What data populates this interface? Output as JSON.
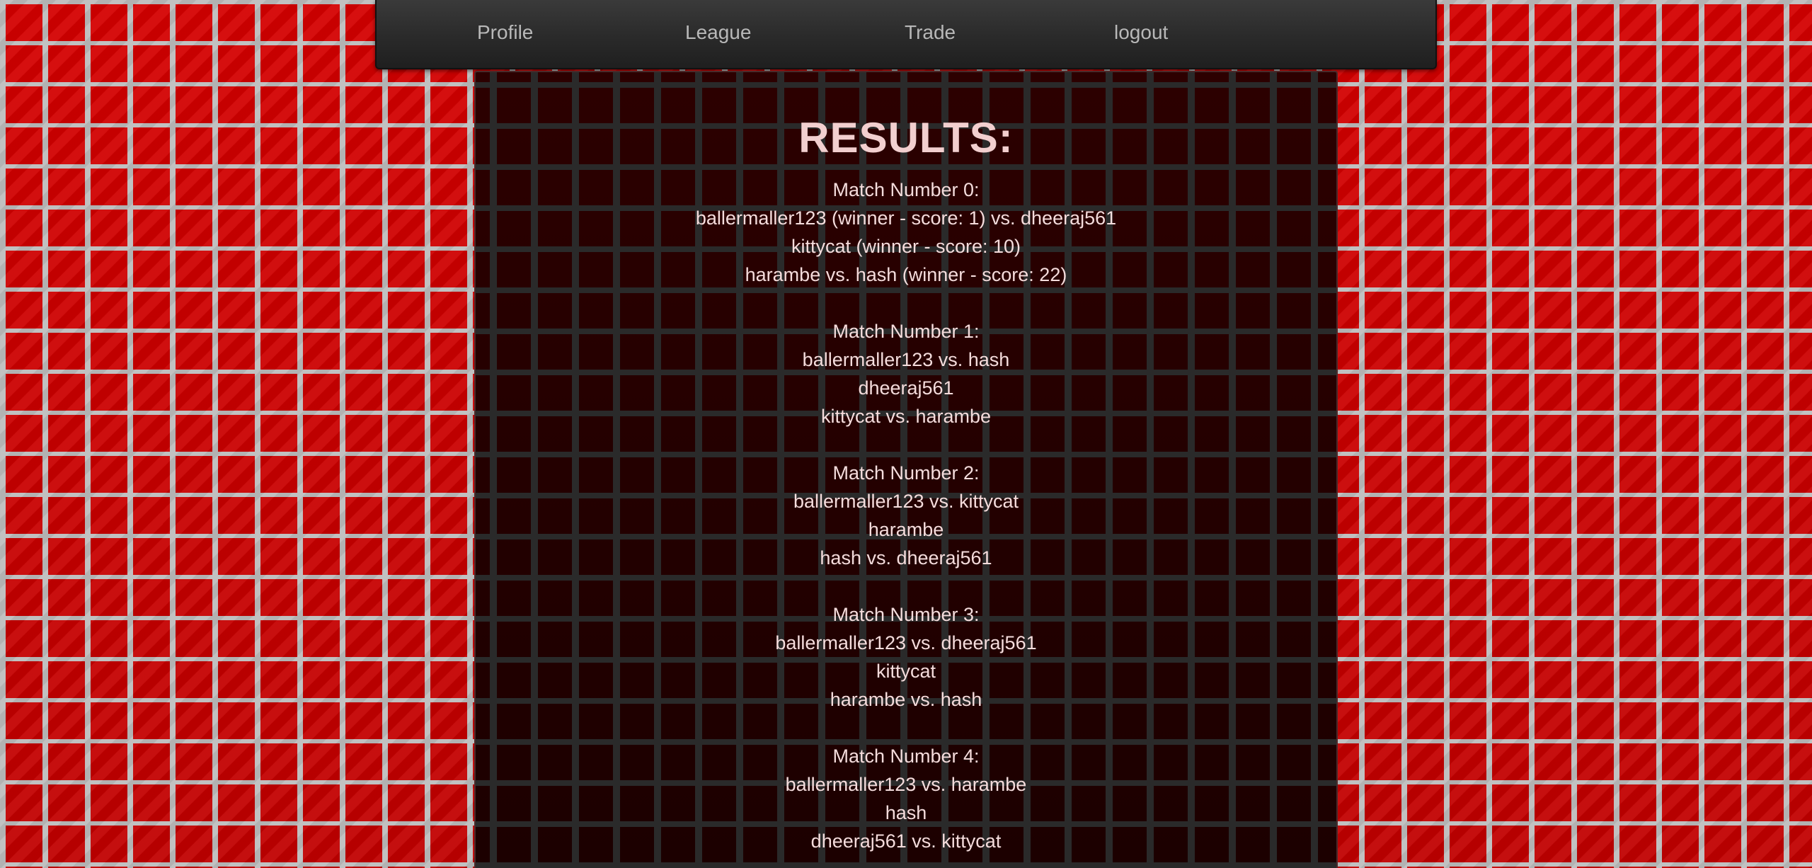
{
  "nav": {
    "profile": "Profile",
    "league": "League",
    "trade": "Trade",
    "logout": "logout"
  },
  "results": {
    "title": "RESULTS:",
    "matches": [
      {
        "header": "Match Number 0:",
        "lines": [
          "ballermaller123 (winner - score: 1) vs. dheeraj561",
          "kittycat (winner - score: 10)",
          "harambe vs. hash (winner - score: 22)"
        ]
      },
      {
        "header": "Match Number 1:",
        "lines": [
          "ballermaller123 vs. hash",
          "dheeraj561",
          "kittycat vs. harambe"
        ]
      },
      {
        "header": "Match Number 2:",
        "lines": [
          "ballermaller123 vs. kittycat",
          "harambe",
          "hash vs. dheeraj561"
        ]
      },
      {
        "header": "Match Number 3:",
        "lines": [
          "ballermaller123 vs. dheeraj561",
          "kittycat",
          "harambe vs. hash"
        ]
      },
      {
        "header": "Match Number 4:",
        "lines": [
          "ballermaller123 vs. harambe",
          "hash",
          "dheeraj561 vs. kittycat"
        ]
      }
    ]
  },
  "colors": {
    "brick": "#c00000",
    "mortar": "#bdbdbd",
    "nav_bg": "#2a2a2a",
    "nav_text": "#b8b8b8",
    "panel_bg": "#1c0000",
    "panel_text": "#f4dcdc"
  }
}
